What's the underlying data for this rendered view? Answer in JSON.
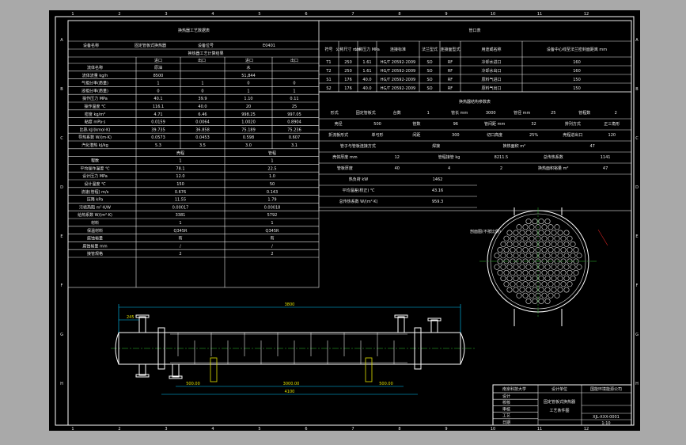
{
  "sheet": {
    "border_letters": [
      "A",
      "B",
      "C",
      "D",
      "E",
      "F",
      "G",
      "H"
    ],
    "border_numbers": [
      "1",
      "2",
      "3",
      "4",
      "5",
      "6",
      "7",
      "8",
      "9",
      "10",
      "11",
      "12"
    ]
  },
  "process_table": {
    "title": "换热器工艺数据表",
    "header_row": [
      "设备名称",
      "固定管板式换热器",
      "设备位号",
      "E0401"
    ],
    "subtitle": "换热器工艺计算结果",
    "col_heads": [
      "进口",
      "出口",
      "进口",
      "出口"
    ],
    "rows": [
      {
        "label": "流体名称",
        "v": [
          "原油",
          "",
          "水",
          ""
        ]
      },
      {
        "label": "流体流量 kg/h",
        "v": [
          "8500",
          "",
          "51,844",
          ""
        ]
      },
      {
        "label": "气相分率(质量)",
        "v": [
          "1",
          "1",
          "0",
          "0"
        ]
      },
      {
        "label": "液相分率(质量)",
        "v": [
          "0",
          "0",
          "1",
          "1"
        ]
      },
      {
        "label": "操作压力 MPa",
        "v": [
          "40.1",
          "39.9",
          "1.10",
          "0.11"
        ]
      },
      {
        "label": "操作温度 ℃",
        "v": [
          "116.1",
          "40.0",
          "20",
          "25"
        ]
      },
      {
        "label": "密度 kg/m³",
        "v": [
          "4.71",
          "6.46",
          "998.25",
          "997.05"
        ]
      },
      {
        "label": "粘度 mPa·s",
        "v": [
          "0.0159",
          "0.0064",
          "1.0020",
          "0.8904"
        ]
      },
      {
        "label": "比热 kJ/(kmol·K)",
        "v": [
          "39.735",
          "36.858",
          "75.189",
          "75.236"
        ]
      },
      {
        "label": "导热系数 W/(m·K)",
        "v": [
          "0.0573",
          "0.0453",
          "0.598",
          "0.607"
        ]
      },
      {
        "label": "汽化潜热 kJ/kg",
        "v": [
          "5.3",
          "3.5",
          "3.0",
          "3.1"
        ]
      }
    ],
    "side_heads": [
      "壳程",
      "管程"
    ],
    "rows2": [
      {
        "label": "程数",
        "v": [
          "1",
          "1"
        ]
      },
      {
        "label": "平均操作温度 ℃",
        "v": [
          "78.1",
          "22.5"
        ]
      },
      {
        "label": "设计压力 MPa",
        "v": [
          "12.0",
          "1.0"
        ]
      },
      {
        "label": "设计温度 ℃",
        "v": [
          "150",
          "50"
        ]
      },
      {
        "label": "流速(管程) m/s",
        "v": [
          "0.676",
          "0.143"
        ]
      },
      {
        "label": "压降 kPa",
        "v": [
          "11.55",
          "1.79"
        ]
      },
      {
        "label": "污垢热阻 m²·K/W",
        "v": [
          "0.00017",
          "0.00018"
        ]
      },
      {
        "label": "给热系数 W/(m²·K)",
        "v": [
          "3381",
          "5792"
        ]
      },
      {
        "label": "材料",
        "v": [
          "1",
          "1"
        ]
      },
      {
        "label": "保温材料",
        "v": [
          "Q345R",
          "Q345R"
        ]
      },
      {
        "label": "腐蚀裕量",
        "v": [
          "有",
          "有"
        ]
      },
      {
        "label": "腐蚀裕量 mm",
        "v": [
          "/",
          "/"
        ]
      },
      {
        "label": "接管规格",
        "v": [
          "2",
          "2"
        ]
      }
    ]
  },
  "nozzle_table": {
    "title": "管口表",
    "head": [
      "符号",
      "公称尺寸 mm",
      "公称压力 MPa",
      "连接标准",
      "法兰型式",
      "连接面型式",
      "用途或名称",
      "设备中心线至法兰密封面距离 mm"
    ],
    "rows": [
      [
        "T1",
        "250",
        "1.61",
        "HG/T 20592-2009",
        "SO",
        "RF",
        "冷却水进口",
        "160"
      ],
      [
        "T2",
        "250",
        "1.61",
        "HG/T 20592-2009",
        "SO",
        "RF",
        "冷却水出口",
        "160"
      ],
      [
        "S1",
        "176",
        "40.0",
        "HG/T 20592-2009",
        "SO",
        "RF",
        "原料气进口",
        "150"
      ],
      [
        "S2",
        "176",
        "40.0",
        "HG/T 20592-2009",
        "SO",
        "RF",
        "原料气出口",
        "150"
      ]
    ]
  },
  "spec_table": {
    "title": "换热器结构参数表",
    "rows": [
      [
        "形式",
        "固定管板式",
        "台数",
        "1",
        "管长 mm",
        "3000",
        "管径 mm",
        "25",
        "管程数",
        "2"
      ],
      [
        "壳径",
        "500",
        "管数",
        "96",
        "管间距 mm",
        "32",
        "排列方式",
        "正三角形"
      ],
      [
        "折流板形式",
        "单弓形",
        "间距",
        "300",
        "切口高度",
        "25%",
        "壳程进出口",
        "120"
      ],
      [
        "管子与管板连接方式",
        "焊接",
        "换热面积 m²",
        "47"
      ],
      [
        "壳体厚度 mm",
        "12",
        "管程接管 kg",
        "8211.5",
        "总传热系数",
        "1141"
      ],
      [
        "管板厚度",
        "40",
        "4",
        "2",
        "换热面积裕量 m²",
        "47"
      ],
      [
        "热负荷 kW",
        "1462"
      ],
      [
        "平均温差(校正) ℃",
        "43.16"
      ],
      [
        "总传热系数 W/(m²·K)",
        "959.3"
      ]
    ]
  },
  "section_label": "剖面图(不按比例)",
  "dimensions": {
    "overall": "3800",
    "left_end": "245",
    "bottom_left": "500.00",
    "bottom_mid": "3000.00",
    "bottom_right": "500.00",
    "bottom_total": "4100"
  },
  "title_block": {
    "school": "南京科技大学",
    "design": "设计单位",
    "project": "国能环境能源公司",
    "drawing_name": "固定管板式换热器",
    "drawing_sub": "工艺条件图",
    "drawing_no": "XJL-XXX-0001",
    "scale": "1:10",
    "rows": [
      "设计",
      "校核",
      "审核",
      "工艺",
      "日期"
    ]
  }
}
